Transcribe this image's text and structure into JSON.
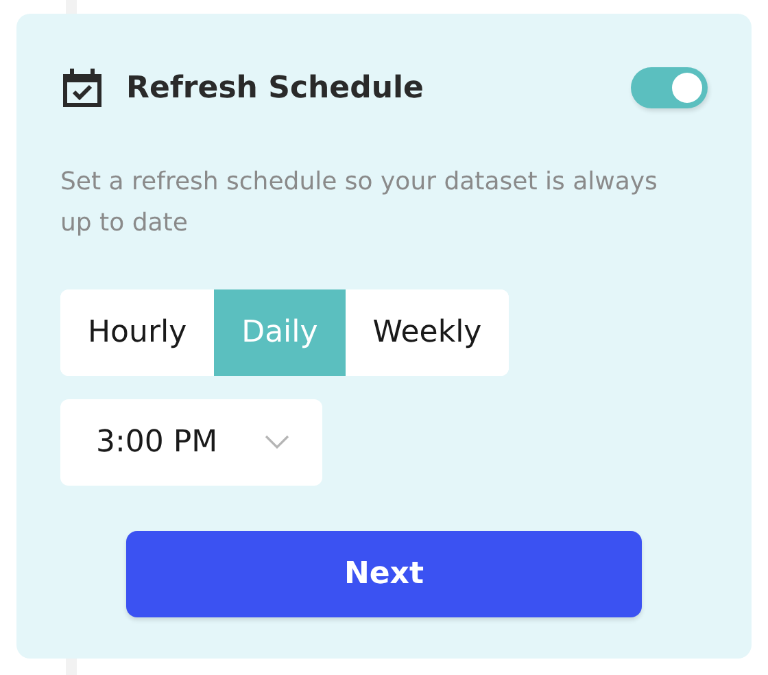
{
  "panel": {
    "title": "Refresh Schedule",
    "toggle": {
      "on": true
    },
    "description": "Set a refresh schedule so your dataset is always up to date"
  },
  "frequency": [
    {
      "label": "Hourly",
      "selected": false
    },
    {
      "label": "Daily",
      "selected": true
    },
    {
      "label": "Weekly",
      "selected": false
    }
  ],
  "time_select": {
    "value": "3:00 PM"
  },
  "buttons": [
    "Next"
  ]
}
